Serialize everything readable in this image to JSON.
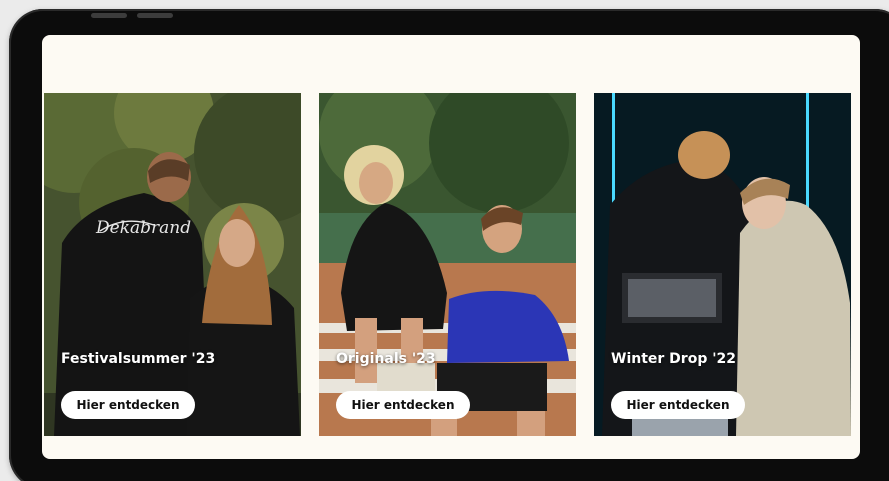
{
  "collections": [
    {
      "title": "Festivalsummer '23",
      "cta": "Hier entdecken",
      "image": "festival-bomber-jackets-couple-photo",
      "jacket_script": "Dekabrand"
    },
    {
      "title": "Originals '23",
      "cta": "Hier entdecken",
      "image": "tennis-court-sweatshirts-photo"
    },
    {
      "title": "Winter Drop '22",
      "cta": "Hier entdecken",
      "image": "night-hoodies-couple-photo"
    }
  ],
  "colors": {
    "page_background": "#fdfaf3",
    "bezel": "#0c0c0c",
    "button_background": "#ffffff",
    "button_text": "#111111",
    "title_text": "#ffffff"
  }
}
